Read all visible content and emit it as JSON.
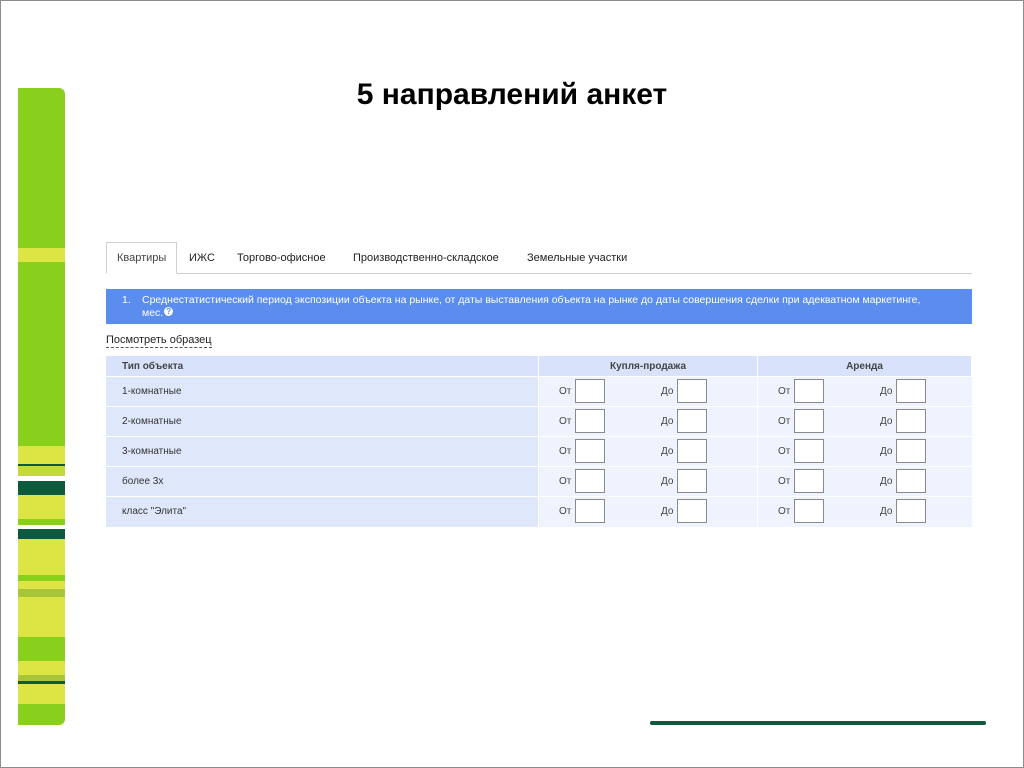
{
  "title": "5 направлений анкет",
  "tabs": [
    {
      "label": "Квартиры",
      "active": true
    },
    {
      "label": "ИЖС",
      "active": false
    },
    {
      "label": "Торгово-офисное",
      "active": false
    },
    {
      "label": "Производственно-складское",
      "active": false
    },
    {
      "label": "Земельные участки",
      "active": false
    }
  ],
  "question": {
    "number": "1.",
    "text": "Среднестатистический период экспозиции объекта на рынке, от даты выставления объекта на рынке до даты совершения сделки при адекватном маркетинге, мес.",
    "help_icon": "question-icon"
  },
  "sample_link": "Посмотреть образец",
  "table": {
    "headers": {
      "type": "Тип объекта",
      "buy": "Купля-продажа",
      "rent": "Аренда"
    },
    "from_label": "От",
    "to_label": "До",
    "rows": [
      {
        "label": "1-комнатные",
        "buy_from": "",
        "buy_to": "",
        "rent_from": "",
        "rent_to": ""
      },
      {
        "label": "2-комнатные",
        "buy_from": "",
        "buy_to": "",
        "rent_from": "",
        "rent_to": ""
      },
      {
        "label": "3-комнатные",
        "buy_from": "",
        "buy_to": "",
        "rent_from": "",
        "rent_to": ""
      },
      {
        "label": "более 3х",
        "buy_from": "",
        "buy_to": "",
        "rent_from": "",
        "rent_to": ""
      },
      {
        "label": "класс \"Элита\"",
        "buy_from": "",
        "buy_to": "",
        "rent_from": "",
        "rent_to": ""
      }
    ]
  },
  "colors": {
    "question_bg": "#5b8def",
    "header_bg": "#d8e3fb",
    "stripe_lime": "#88d01c",
    "stripe_yellow": "#dde545",
    "stripe_dark": "#0e5a3c",
    "footer_line": "#0e5a3c"
  }
}
